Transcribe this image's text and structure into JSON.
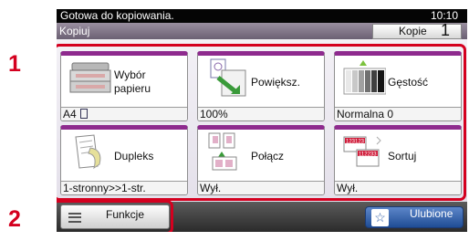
{
  "callouts": [
    "1",
    "2"
  ],
  "status": {
    "message": "Gotowa do kopiowania.",
    "time": "10:10"
  },
  "header": {
    "title": "Kopiuj",
    "copies_label": "Kopie",
    "copies_value": "1"
  },
  "tiles": [
    {
      "label_line1": "Wybór",
      "label_line2": "papieru",
      "value": "A4",
      "icon": "paper-tray-icon"
    },
    {
      "label": "Powiększ.",
      "value": "100%",
      "icon": "zoom-icon"
    },
    {
      "label": "Gęstość",
      "value": "Normalna 0",
      "icon": "density-icon"
    },
    {
      "label": "Dupleks",
      "value": "1-stronny>>1-str.",
      "icon": "duplex-icon"
    },
    {
      "label": "Połącz",
      "value": "Wył.",
      "icon": "combine-icon"
    },
    {
      "label": "Sortuj",
      "value": "Wył.",
      "icon": "collate-icon"
    }
  ],
  "footer": {
    "functions_label": "Funkcje",
    "favorites_label": "Ulubione"
  },
  "colors": {
    "accent": "#8e2a8e",
    "highlight": "#d4001f",
    "favorites": "#2f5ea8"
  }
}
